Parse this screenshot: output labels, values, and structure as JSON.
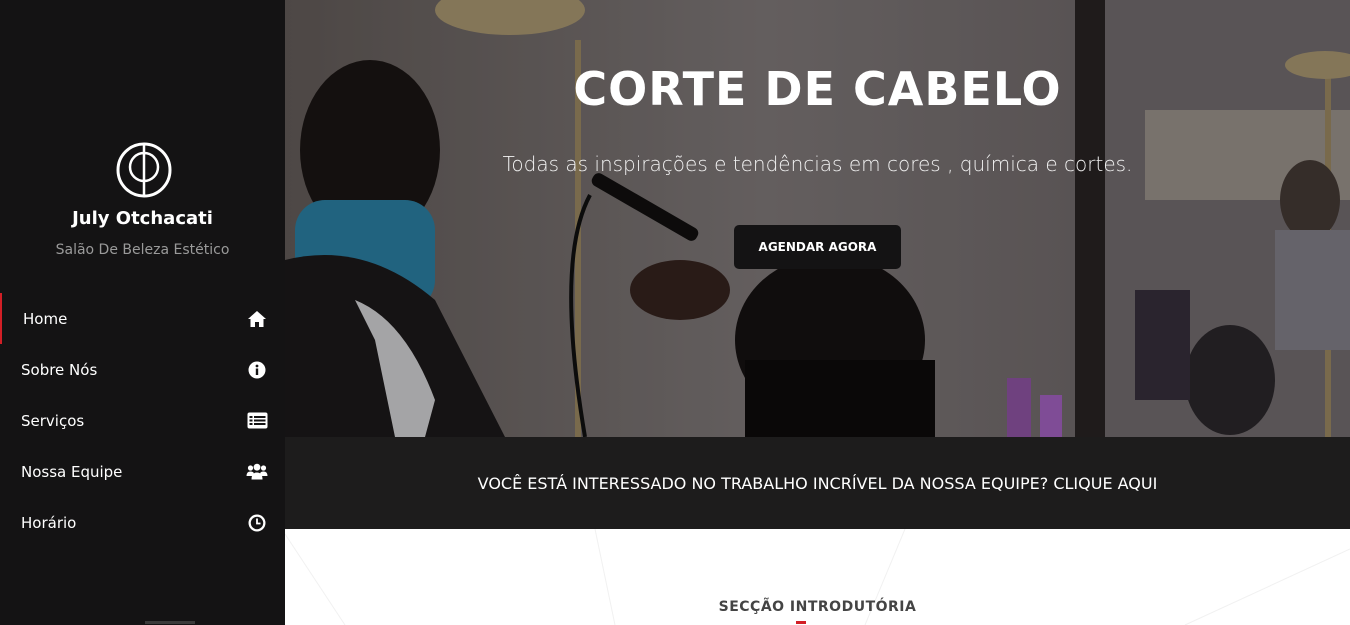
{
  "sidebar": {
    "brand_name": "July Otchacati",
    "brand_subtitle": "Salão De Beleza Estético",
    "logo_icon": "circle-monogram-logo",
    "items": [
      {
        "label": "Home",
        "icon": "home-icon",
        "active": true
      },
      {
        "label": "Sobre Nós",
        "icon": "info-icon",
        "active": false
      },
      {
        "label": "Serviços",
        "icon": "list-icon",
        "active": false
      },
      {
        "label": "Nossa Equipe",
        "icon": "users-icon",
        "active": false
      },
      {
        "label": "Horário",
        "icon": "clock-icon",
        "active": false
      }
    ]
  },
  "hero": {
    "title": "CORTE DE CABELO",
    "subtitle": "Todas as inspirações e tendências em cores , química e cortes.",
    "cta_label": "AGENDAR AGORA"
  },
  "banner": {
    "text": "VOCÊ ESTÁ INTERESSADO NO TRABALHO INCRÍVEL DA NOSSA EQUIPE? CLIQUE AQUI"
  },
  "intro": {
    "title": "SECÇÃO INTRODUTÓRIA"
  },
  "colors": {
    "sidebar_bg": "#141314",
    "accent": "#d21f26",
    "banner_bg": "#1d1c1c"
  }
}
